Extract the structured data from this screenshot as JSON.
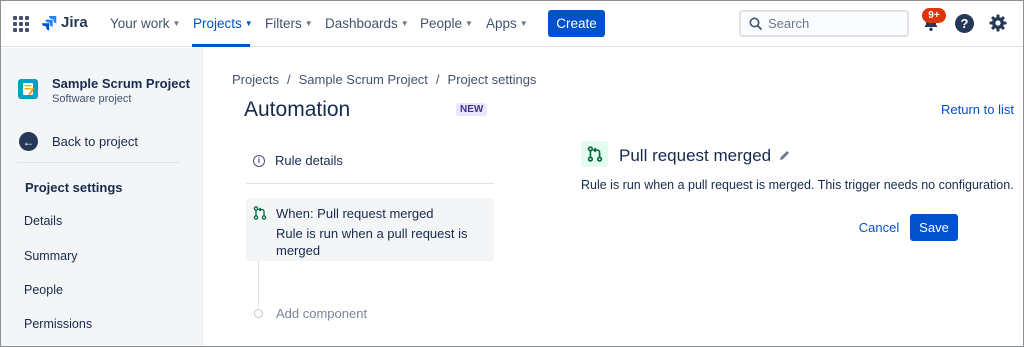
{
  "topnav": {
    "logo_text": "Jira",
    "items": [
      {
        "label": "Your work"
      },
      {
        "label": "Projects"
      },
      {
        "label": "Filters"
      },
      {
        "label": "Dashboards"
      },
      {
        "label": "People"
      },
      {
        "label": "Apps"
      }
    ],
    "active_item": "Projects",
    "create_label": "Create",
    "search_placeholder": "Search",
    "notification_badge": "9+",
    "help_glyph": "?",
    "icons": [
      "app-switcher-icon",
      "jira-logo-icon",
      "search-icon",
      "bell-icon",
      "help-icon",
      "gear-icon"
    ],
    "accent_color": "#0052cc"
  },
  "sidebar": {
    "project_name": "Sample Scrum Project",
    "project_type": "Software project",
    "back_label": "Back to project",
    "heading": "Project settings",
    "items": [
      {
        "label": "Details"
      },
      {
        "label": "Summary"
      },
      {
        "label": "People"
      },
      {
        "label": "Permissions"
      }
    ]
  },
  "main": {
    "breadcrumb": [
      "Projects",
      "Sample Scrum Project",
      "Project settings"
    ],
    "breadcrumb_separator": "/",
    "title": "Automation",
    "new_badge": "NEW",
    "return_link": "Return to list",
    "rule_details_label": "Rule details",
    "trigger": {
      "title": "When: Pull request merged",
      "description": "Rule is run when a pull request is merged"
    },
    "add_component_label": "Add component",
    "detail": {
      "title": "Pull request merged",
      "description": "Rule is run when a pull request is merged. This trigger needs no configuration.",
      "cancel_label": "Cancel",
      "save_label": "Save"
    }
  }
}
